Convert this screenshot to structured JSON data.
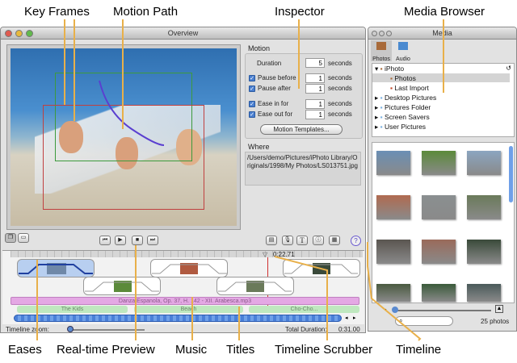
{
  "callouts": {
    "key_frames": "Key Frames",
    "motion_path": "Motion Path",
    "inspector": "Inspector",
    "media_browser": "Media Browser",
    "eases": "Eases",
    "realtime_preview": "Real-time Preview",
    "music": "Music",
    "titles": "Titles",
    "timeline_scrubber": "Timeline Scrubber",
    "timeline": "Timeline"
  },
  "main_window": {
    "title": "Overview",
    "inspector": {
      "motion_heading": "Motion",
      "duration_label": "Duration",
      "duration_value": "5",
      "pause_before_label": "Pause before",
      "pause_before_value": "1",
      "pause_after_label": "Pause after",
      "pause_after_value": "1",
      "ease_in_label": "Ease in for",
      "ease_in_value": "1",
      "ease_out_label": "Ease out for",
      "ease_out_value": "1",
      "unit": "seconds",
      "templates_button": "Motion Templates...",
      "where_heading": "Where",
      "where_path": "/Users/demo/Pictures/iPhoto Library/Originals/1998/My Photos/LS013751.jpg"
    },
    "timeline": {
      "scrubber_time": "0:22.71",
      "music_track": "Danza Espanola, Op. 37, H. 142 - XII. Arabesca.mp3",
      "titles": [
        "The Kids",
        "Beach",
        "Cho-Cho..."
      ],
      "zoom_label": "Timeline zoom:",
      "total_duration_label": "Total Duration:",
      "total_duration_value": "0:31.00"
    }
  },
  "media_window": {
    "title": "Media",
    "tabs": [
      "Photos",
      "Audio"
    ],
    "tree": [
      "iPhoto",
      "Photos",
      "Last Import",
      "Desktop Pictures",
      "Pictures Folder",
      "Screen Savers",
      "User Pictures"
    ],
    "photo_count": "25 photos",
    "thumb_colors": [
      "#6a8fb5",
      "#5b8a3a",
      "#8ba5c0",
      "#b06a50",
      "#8a8f90",
      "#6a7a5a",
      "#5a5550",
      "#9a6a5a",
      "#3a4a3a",
      "#4a5a40",
      "#3a5a3a",
      "#4a5a5a"
    ]
  }
}
